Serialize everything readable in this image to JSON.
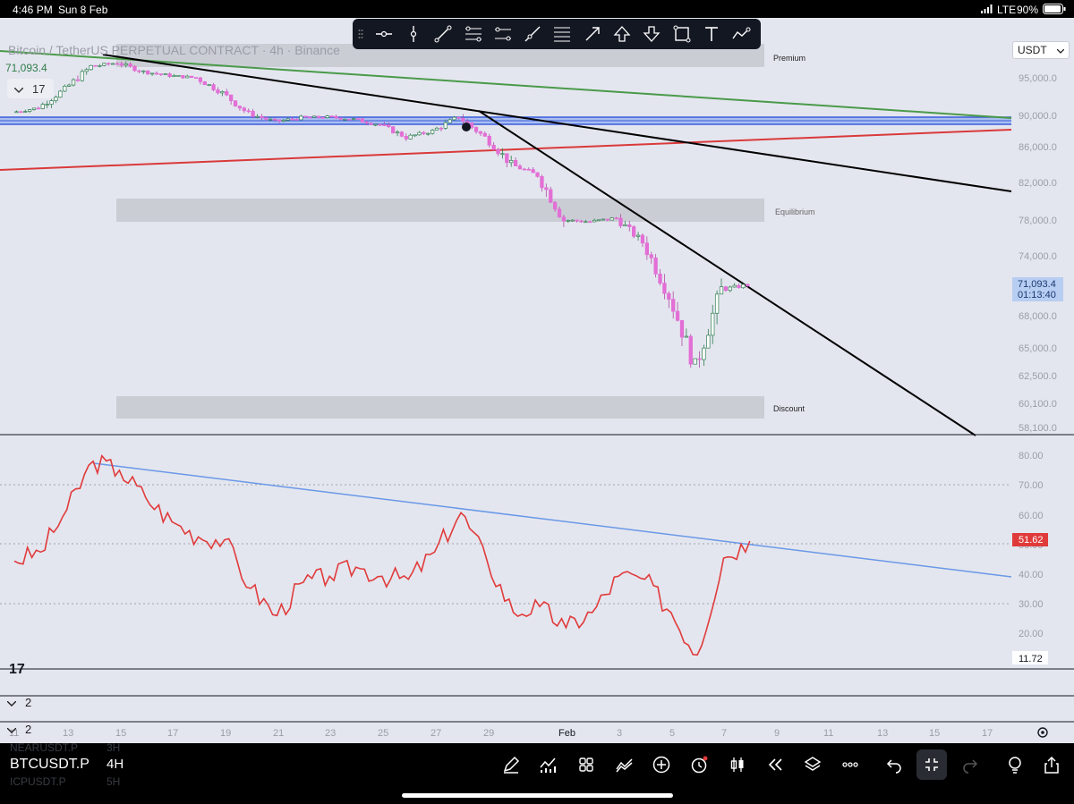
{
  "status_bar": {
    "time": "4:46 PM",
    "date": "Sun 8 Feb",
    "network": "LTE",
    "battery": "90%"
  },
  "header": {
    "title": "Bitcoin / TetherUS PERPETUAL CONTRACT · 4h · Binance",
    "last_price": "71,093.4",
    "indicator_count": "17",
    "currency": "USDT"
  },
  "drawing_toolbar": {
    "tools": [
      "horizontal-ray",
      "vertical-line",
      "trend-line",
      "parallel-channel",
      "regression-trend",
      "ray",
      "fib-retracement",
      "arrow",
      "arrow-mark-up",
      "arrow-mark-down",
      "rectangle",
      "text",
      "path"
    ]
  },
  "chart_data": [
    {
      "type": "candlestick",
      "title": "Bitcoin / TetherUS PERPETUAL CONTRACT · 4h · Binance",
      "y_ticks": [
        "95,000.0",
        "90,000.0",
        "86,000.0",
        "82,000.0",
        "78,000.0",
        "74,000.0",
        "68,000.0",
        "65,000.0",
        "62,500.0",
        "60,100.0",
        "58,100.0"
      ],
      "x_ticks": [
        "11",
        "13",
        "15",
        "17",
        "19",
        "21",
        "23",
        "25",
        "27",
        "29",
        "Feb",
        "3",
        "5",
        "7",
        "9",
        "11",
        "13",
        "15",
        "17"
      ],
      "current_price": "71,093.4",
      "countdown": "01:13:40",
      "zones": [
        {
          "label": "Premium"
        },
        {
          "label": "Equilibrium"
        },
        {
          "label": "Discount"
        }
      ],
      "trend_lines": [
        {
          "color": "#000000",
          "note": "descending resistance from January high"
        },
        {
          "color": "#000000",
          "note": "steep descending resistance from late-January high"
        },
        {
          "color": "#4a9a4a",
          "note": "long-term green line"
        },
        {
          "color": "#d93a3a",
          "note": "rising red line"
        },
        {
          "color": "#3b5bdb",
          "note": "horizontal blue level near 90,000"
        }
      ],
      "close_path": [
        [
          "Jan 11",
          90400
        ],
        [
          "Jan 12",
          91000
        ],
        [
          "Jan 13",
          93500
        ],
        [
          "Jan 14",
          96500
        ],
        [
          "Jan 15",
          97000
        ],
        [
          "Jan 16",
          95800
        ],
        [
          "Jan 17",
          95300
        ],
        [
          "Jan 18",
          95000
        ],
        [
          "Jan 19",
          93000
        ],
        [
          "Jan 20",
          90200
        ],
        [
          "Jan 21",
          89200
        ],
        [
          "Jan 22",
          89700
        ],
        [
          "Jan 23",
          89800
        ],
        [
          "Jan 24",
          89500
        ],
        [
          "Jan 25",
          88800
        ],
        [
          "Jan 26",
          87200
        ],
        [
          "Jan 27",
          88000
        ],
        [
          "Jan 28",
          89800
        ],
        [
          "Jan 29",
          87200
        ],
        [
          "Jan 30",
          84000
        ],
        [
          "Jan 31",
          82800
        ],
        [
          "Feb 1",
          78000
        ],
        [
          "Feb 2",
          77800
        ],
        [
          "Feb 3",
          78200
        ],
        [
          "Feb 4",
          75500
        ],
        [
          "Feb 5",
          70000
        ],
        [
          "Feb 6",
          63200
        ],
        [
          "Feb 7",
          70600
        ],
        [
          "Feb 8",
          71093.4
        ]
      ],
      "candle_up_color": "#2e7d4f",
      "candle_down_color": "#e36fd6"
    },
    {
      "type": "line",
      "title": "",
      "y_ticks": [
        "80.00",
        "70.00",
        "60.00",
        "50.00",
        "40.00",
        "30.00",
        "20.00"
      ],
      "current_value": "51.62",
      "low_value_label": "11.72",
      "series_color": "#e03b3b",
      "trend_line_color": "#6a98e8",
      "values": [
        [
          "Jan 11",
          45
        ],
        [
          "Jan 12",
          48
        ],
        [
          "Jan 13",
          62
        ],
        [
          "Jan 14",
          78
        ],
        [
          "Jan 15",
          75
        ],
        [
          "Jan 16",
          66
        ],
        [
          "Jan 17",
          58
        ],
        [
          "Jan 18",
          53
        ],
        [
          "Jan 19",
          52
        ],
        [
          "Jan 20",
          36
        ],
        [
          "Jan 21",
          27
        ],
        [
          "Jan 22",
          38
        ],
        [
          "Jan 23",
          40
        ],
        [
          "Jan 24",
          43
        ],
        [
          "Jan 25",
          40
        ],
        [
          "Jan 26",
          39
        ],
        [
          "Jan 27",
          48
        ],
        [
          "Jan 28",
          61
        ],
        [
          "Jan 29",
          45
        ],
        [
          "Jan 30",
          28
        ],
        [
          "Jan 31",
          30
        ],
        [
          "Feb 1",
          23
        ],
        [
          "Feb 2",
          28
        ],
        [
          "Feb 3",
          40
        ],
        [
          "Feb 4",
          39
        ],
        [
          "Feb 5",
          28
        ],
        [
          "Feb 6",
          14
        ],
        [
          "Feb 7",
          46
        ],
        [
          "Feb 8",
          51.62
        ]
      ]
    }
  ],
  "panes": [
    {
      "count": "2"
    },
    {
      "count": "2"
    }
  ],
  "bottom_bar": {
    "symbol": "BTCUSDT.P",
    "timeframe": "4H",
    "ghost_symbol_1": "NEARUSDT.P",
    "ghost_tf_1": "3H",
    "ghost_symbol_2": "ICPUSDT.P",
    "ghost_tf_2": "5H"
  },
  "branding": {
    "logo": "17"
  }
}
